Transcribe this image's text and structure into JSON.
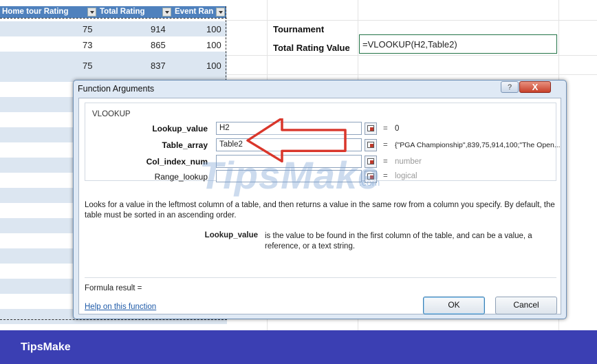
{
  "table": {
    "headers": [
      "Home tour Rating",
      "Total Rating",
      "Event Ran"
    ],
    "rows": [
      [
        "75",
        "914",
        "100"
      ],
      [
        "73",
        "865",
        "100"
      ],
      [
        "75",
        "837",
        "100"
      ]
    ]
  },
  "sheet": {
    "tournament_label": "Tournament",
    "total_rating_label": "Total Rating Value",
    "formula": "=VLOOKUP(H2,Table2)"
  },
  "dialog": {
    "title": "Function Arguments",
    "help_glyph": "?",
    "close_glyph": "X",
    "function_name": "VLOOKUP",
    "args": [
      {
        "label": "Lookup_value",
        "value": "H2",
        "result": "0"
      },
      {
        "label": "Table_array",
        "value": "Table2",
        "result": "{\"PGA Championship\",839,75,914,100;\"The Open..."
      },
      {
        "label": "Col_index_num",
        "value": "",
        "result": "number"
      },
      {
        "label": "Range_lookup",
        "value": "",
        "result": "logical"
      }
    ],
    "equals": "=",
    "description": "Looks for a value in the leftmost column of a table, and then returns a value in the same row from a column you specify. By default, the table must be sorted in an ascending order.",
    "arg_help_name": "Lookup_value",
    "arg_help_text": "is the value to be found in the first column of the table, and can be a value, a reference, or a text string.",
    "formula_result": "Formula result =",
    "help_link": "Help on this function",
    "ok": "OK",
    "cancel": "Cancel"
  },
  "watermark": {
    "text": "TipsMake",
    "suffix": ".com"
  },
  "footer": {
    "brand": "TipsMake"
  },
  "colors": {
    "header_blue": "#4f81bd",
    "band": "#dce6f1",
    "footer": "#3b3fb3",
    "arrow": "#d9362b",
    "selected_border": "#217346"
  }
}
